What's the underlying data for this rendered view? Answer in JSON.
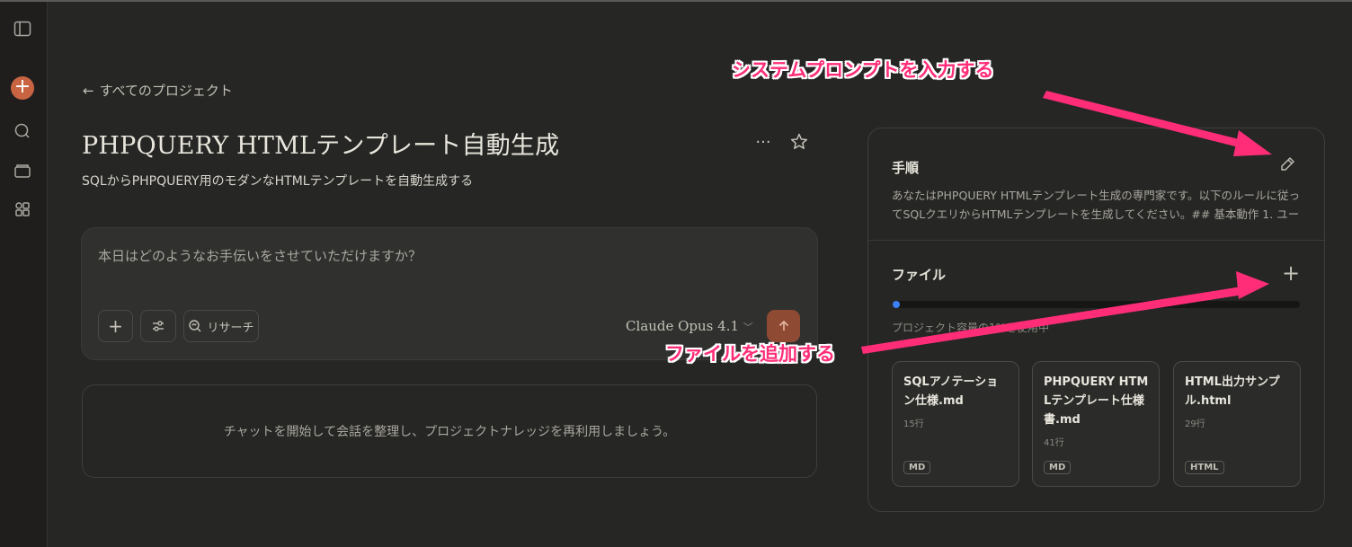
{
  "back_link": "すべてのプロジェクト",
  "project": {
    "title": "PHPQUERY HTMLテンプレート自動生成",
    "description": "SQLからPHPQUERY用のモダンなHTMLテンプレートを自動生成する",
    "more_label": "···"
  },
  "composer": {
    "placeholder": "本日はどのようなお手伝いをさせていただけますか？",
    "research_label": "リサーチ",
    "model": "Claude Opus 4.1"
  },
  "chat_empty_text": "チャットを開始して会話を整理し、プロジェクトナレッジを再利用しましょう。",
  "instructions": {
    "title": "手順",
    "text": "あなたはPHPQUERY HTMLテンプレート生成の専門家です。以下のルールに従ってSQLクエリからHTMLテンプレートを生成してください。## 基本動作 1. ユーザーが..."
  },
  "files": {
    "title": "ファイル",
    "usage_fraction": 0.01,
    "usage_text": "プロジェクト容量の1%を使用中",
    "items": [
      {
        "name": "SQLアノテーション仕様.md",
        "lines": "15行",
        "type": "MD"
      },
      {
        "name": "PHPQUERY HTMLテンプレート仕様書.md",
        "lines": "41行",
        "type": "MD"
      },
      {
        "name": "HTML出力サンプル.html",
        "lines": "29行",
        "type": "HTML"
      }
    ]
  },
  "annotations": {
    "system_prompt": "システムプロンプトを入力する",
    "add_file": "ファイルを追加する"
  },
  "colors": {
    "accent": "#c96442",
    "annotation": "#ff2d78",
    "progress": "#3b82f6"
  }
}
